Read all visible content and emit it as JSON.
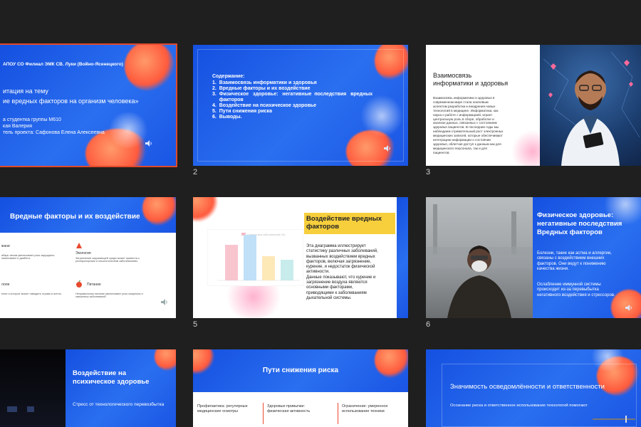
{
  "slides": [
    {
      "number": "",
      "lines": [
        "АПОУ СО Филиал ЭМК СВ. Луки (Войно-Ясенецкого)",
        "итация на тему",
        "ие вредных факторов на организм человека»",
        "а студентка группы М610",
        "кая Валерия",
        "тель проекта: Сафонова Елена Алексеевна"
      ]
    },
    {
      "number": "2",
      "heading": "Содержание:",
      "items": [
        "1.  Взаимосвязь информатики и здоровья",
        "2.  Вредные факторы и их воздействие",
        "3.  Физическое   здоровье:   негативные  последствия   вредных",
        "     факторов",
        "4.  Воздействие на психическое здоровье",
        "5.  Пути снижения риска",
        "6.  Выводы."
      ]
    },
    {
      "number": "3",
      "title_lines": [
        "Взаимосвязь",
        "информатики и здоровья"
      ],
      "body_lines": [
        "Взаимосвязь информатики и здоровья в",
        "современном мире стала ключевым",
        "аспектом разработки и внедрения новых",
        "технологий в медицине. Информатика, как",
        "наука о работе с информацией, играет",
        "центральную роль в сборе, обработке и",
        "анализе данных, связанных с состоянием",
        "здоровья пациентов. В последние годы мы",
        "наблюдаем стремительный рост электронных",
        "медицинских записей, которые обеспечивают",
        "интеграцию информации о состоянии",
        "здоровья, облегчая доступ к данным как для",
        "медицинского персонала, так и для",
        "пациентов."
      ]
    },
    {
      "number": "",
      "title": "Вредные факторы и их воздействие",
      "items": [
        {
          "label": "жани",
          "text": "ибарь своим увеличивает риск заруждено-наметивают и диабета."
        },
        {
          "label": "Экология",
          "text": "Загрязнение окружающей среды может привести к респираторным и онкологическим заболеваниям."
        },
        {
          "label": "лоли",
          "text": "ение и которое может наводить отраво в агечть"
        },
        {
          "label": "Питание",
          "text": "Неправильная питание увеличивает риск ожирения и связанных заболеваний."
        }
      ]
    },
    {
      "number": "5",
      "title_lines": [
        "Воздействие вредных",
        "факторов"
      ],
      "body_lines": [
        "Эта диаграмма иллюстрирует",
        "статистику различных заболеваний,",
        "вызванных воздействием вредных",
        "факторов, включая загрязнение,",
        "курение, и недостаток физической",
        "активности.",
        "Данные показывают, что курение и",
        "загрязнение воздуха являются",
        "основными факторами,",
        "приводящими к заболеваниям",
        "дыхательной системы."
      ],
      "chart_legend": "Статистика заболеваний (%)"
    },
    {
      "number": "6",
      "title_lines": [
        "Физическое здоровье:",
        "негативные последствия",
        "Вредных факторов"
      ],
      "body_lines": [
        "Болезни, такие как астма и аллергии,",
        "связаны с воздействием внешних",
        "факторов. Они ведут к понижению",
        "качества жизни."
      ],
      "body2_lines": [
        "Ослабление иммунной системы",
        "происходит из-за перевыбытка",
        "негативного воздействия и стрессоров."
      ]
    },
    {
      "number": "",
      "title_lines": [
        "Воздействие на",
        "психическое здоровье"
      ],
      "body": "Стресс от технологического перевозбытка"
    },
    {
      "number": "",
      "title": "Пути снижения риска",
      "cols": [
        "Профилактика: регулярные",
        "Здоровые привычки:",
        "Ограничение: умеренное"
      ],
      "cols2": [
        "медицинские осмотры",
        "физическая активность",
        "использование техники"
      ]
    },
    {
      "number": "",
      "title": "Значимость осведомлённости и ответственности",
      "body": "Осознание риска и ответственное использование технологий помогают"
    }
  ],
  "colors": {
    "accent_blue": "#1f5de8",
    "orange": "#ff5a3c",
    "yellow_box": "#f7cf3d",
    "selection": "#e04a2a"
  }
}
